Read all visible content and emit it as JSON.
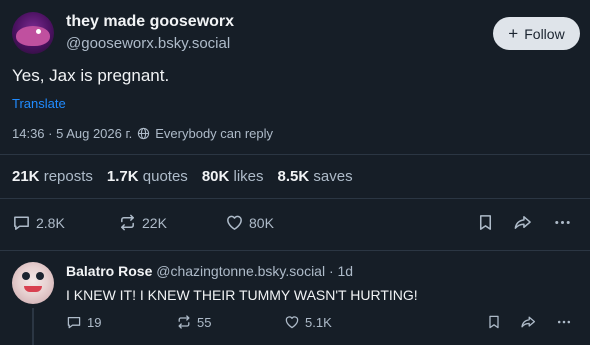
{
  "post": {
    "author_name": "they made gooseworx",
    "author_handle": "@gooseworx.bsky.social",
    "follow_label": "Follow",
    "text": "Yes, Jax is pregnant.",
    "translate_label": "Translate",
    "timestamp": "14:36 · 5 Aug 2026 г.",
    "reply_setting": "Everybody can reply",
    "stats": {
      "reposts_count": "21K",
      "reposts_label": "reposts",
      "quotes_count": "1.7K",
      "quotes_label": "quotes",
      "likes_count": "80K",
      "likes_label": "likes",
      "saves_count": "8.5K",
      "saves_label": "saves"
    },
    "actions": {
      "replies": "2.8K",
      "reposts": "22K",
      "likes": "80K"
    }
  },
  "reply": {
    "author_name": "Balatro Rose",
    "author_handle": "@chazingtonne.bsky.social",
    "age": "· 1d",
    "text": "I KNEW IT! I KNEW THEIR TUMMY WASN'T HURTING!",
    "actions": {
      "replies": "19",
      "reposts": "55",
      "likes": "5.1K"
    }
  },
  "colors": {
    "background": "#161e27",
    "link": "#208bfe",
    "muted": "#aebbc9",
    "follow_button": "#dfe4ea"
  }
}
